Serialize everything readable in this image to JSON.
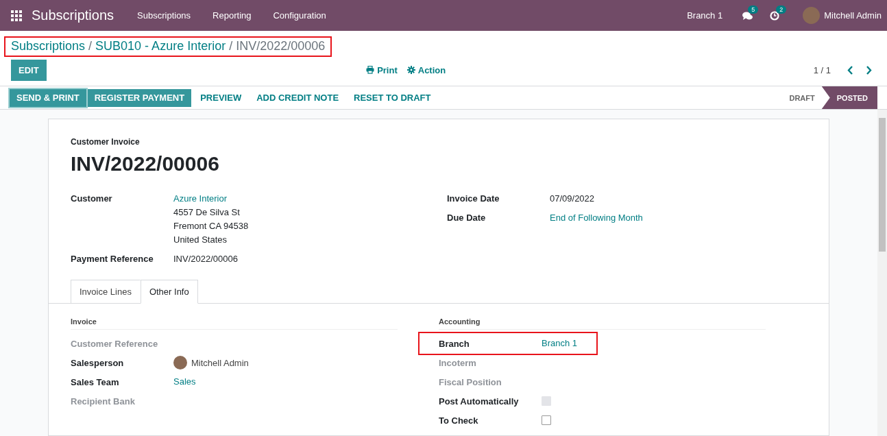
{
  "navbar": {
    "app_name": "Subscriptions",
    "menu": [
      "Subscriptions",
      "Reporting",
      "Configuration"
    ],
    "branch": "Branch 1",
    "messages_count": "5",
    "activities_count": "2",
    "user": "Mitchell Admin"
  },
  "breadcrumb": {
    "highlighted": true,
    "separator": "/",
    "items": [
      {
        "label": "Subscriptions",
        "kind": "link"
      },
      {
        "label": "SUB010 - Azure Interior",
        "kind": "link"
      },
      {
        "label": "INV/2022/00006",
        "kind": "current"
      }
    ]
  },
  "control_panel": {
    "edit": "EDIT",
    "print": "Print",
    "action": "Action",
    "pager": "1 / 1"
  },
  "actions": [
    {
      "label": "SEND & PRINT",
      "kind": "primary"
    },
    {
      "label": "REGISTER PAYMENT",
      "kind": "primary"
    },
    {
      "label": "PREVIEW",
      "kind": "link"
    },
    {
      "label": "ADD CREDIT NOTE",
      "kind": "link"
    },
    {
      "label": "RESET TO DRAFT",
      "kind": "link"
    }
  ],
  "statuses": [
    {
      "label": "DRAFT",
      "selected": false
    },
    {
      "label": "POSTED",
      "selected": true
    }
  ],
  "invoice": {
    "type_label": "Customer Invoice",
    "number": "INV/2022/00006",
    "left_fields": [
      {
        "label": "Customer",
        "kind": "text",
        "lines": [
          {
            "text": "Azure Interior",
            "link": true
          },
          {
            "text": "4557 De Silva St",
            "link": false
          },
          {
            "text": "Fremont CA 94538",
            "link": false
          },
          {
            "text": "United States",
            "link": false
          }
        ]
      },
      {
        "label": "Payment Reference",
        "kind": "text",
        "lines": [
          {
            "text": "INV/2022/00006",
            "link": false
          }
        ]
      }
    ],
    "right_fields": [
      {
        "label": "Invoice Date",
        "kind": "text",
        "lines": [
          {
            "text": "07/09/2022",
            "link": false
          }
        ]
      },
      {
        "label": "Due Date",
        "kind": "text",
        "lines": [
          {
            "text": "End of Following Month",
            "link": true
          }
        ]
      }
    ]
  },
  "tabs": [
    {
      "label": "Invoice Lines",
      "selected": false
    },
    {
      "label": "Other Info",
      "selected": true
    }
  ],
  "other_info": [
    {
      "title": "Invoice",
      "fields": [
        {
          "label": "Customer Reference",
          "kind": "empty"
        },
        {
          "label": "Salesperson",
          "kind": "user",
          "value": "Mitchell Admin"
        },
        {
          "label": "Sales Team",
          "kind": "link",
          "value": "Sales"
        },
        {
          "label": "Recipient Bank",
          "kind": "empty"
        }
      ]
    },
    {
      "title": "Accounting",
      "fields": [
        {
          "label": "Branch",
          "kind": "link",
          "value": "Branch 1",
          "highlighted": true
        },
        {
          "label": "Incoterm",
          "kind": "empty"
        },
        {
          "label": "Fiscal Position",
          "kind": "empty"
        },
        {
          "label": "Post Automatically",
          "kind": "checkbox",
          "checked": false,
          "disabled": true
        },
        {
          "label": "To Check",
          "kind": "checkbox",
          "checked": false,
          "disabled": false
        }
      ]
    }
  ]
}
